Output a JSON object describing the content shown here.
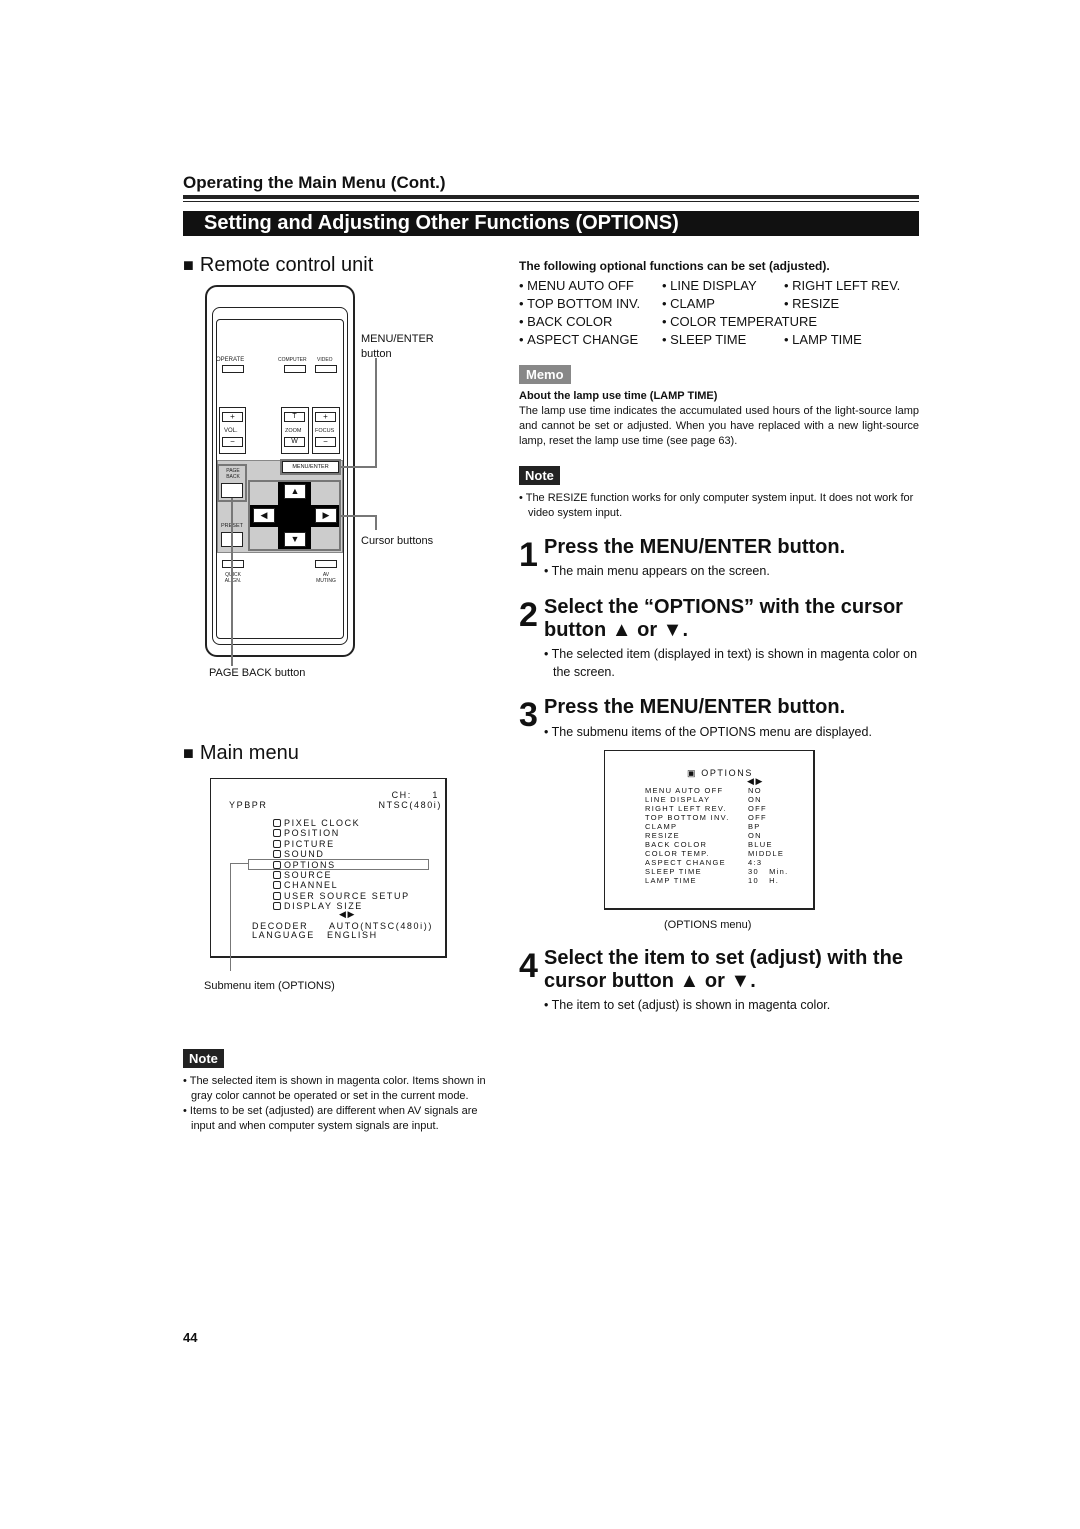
{
  "header": {
    "section": "Operating the Main Menu (Cont.)",
    "title": "Setting and Adjusting Other Functions (OPTIONS)"
  },
  "remote": {
    "heading": "Remote control unit",
    "buttons": {
      "operate": "OPERATE",
      "computer": "COMPUTER",
      "video": "VIDEO",
      "vol": "VOL.",
      "zoom": "ZOOM",
      "focus": "FOCUS",
      "t": "T",
      "w": "W",
      "plus": "+",
      "minus": "−",
      "menu_enter": "MENU/ENTER",
      "page_back": "PAGE BACK",
      "preset": "PRESET",
      "quick_align": "QUICK ALIGN.",
      "av_muting": "AV MUTING"
    },
    "callouts": {
      "menu_enter": "MENU/ENTER button",
      "cursor": "Cursor buttons",
      "page_back": "PAGE BACK button"
    }
  },
  "main_menu": {
    "heading": "Main menu",
    "source": "YPBPR",
    "ch": "CH:     1",
    "signal": "NTSC(480i)",
    "items": [
      "PIXEL CLOCK",
      "POSITION",
      "PICTURE",
      "SOUND",
      "OPTIONS",
      "SOURCE",
      "CHANNEL",
      "USER SOURCE SETUP",
      "DISPLAY SIZE"
    ],
    "selected": "OPTIONS",
    "settings": [
      {
        "label": "DECODER",
        "value": "AUTO(NTSC(480i))"
      },
      {
        "label": "LANGUAGE",
        "value": "ENGLISH"
      }
    ],
    "caption": "Submenu item (OPTIONS)"
  },
  "left_note": {
    "badge": "Note",
    "items": [
      "The selected item is shown in magenta color. Items shown in gray color cannot be operated or set in the current mode.",
      "Items to be set (adjusted) are different when AV signals are input and when computer system signals are input."
    ]
  },
  "functions": {
    "heading": "The following optional functions can be set (adjusted).",
    "rows": [
      [
        "MENU AUTO OFF",
        "LINE DISPLAY",
        "RIGHT LEFT REV."
      ],
      [
        "TOP BOTTOM INV.",
        "CLAMP",
        "RESIZE"
      ],
      [
        "BACK COLOR",
        "COLOR TEMPERATURE",
        ""
      ],
      [
        "ASPECT CHANGE",
        "SLEEP TIME",
        "LAMP TIME"
      ]
    ]
  },
  "memo": {
    "badge": "Memo",
    "heading": "About the lamp use time (LAMP TIME)",
    "text": "The lamp use time indicates the accumulated used hours of the light-source lamp and cannot be set or adjusted. When you have replaced with a new light-source lamp, reset the lamp use time (see page 63)."
  },
  "right_note": {
    "badge": "Note",
    "text": "The RESIZE function works for only computer system input. It does not work for video system input."
  },
  "steps": [
    {
      "num": "1",
      "title": "Press the MENU/ENTER button.",
      "bullet": "The main menu appears on the screen."
    },
    {
      "num": "2",
      "title": "Select the “OPTIONS” with the cursor button ▲ or ▼.",
      "bullet": "The selected item (displayed in text) is shown in magenta color on the screen."
    },
    {
      "num": "3",
      "title": "Press the MENU/ENTER button.",
      "bullet": "The submenu items of the OPTIONS menu are displayed."
    },
    {
      "num": "4",
      "title": "Select the item to set (adjust) with the cursor button ▲ or ▼.",
      "bullet": "The item to set (adjust) is shown in magenta color."
    }
  ],
  "options_menu": {
    "title": "OPTIONS",
    "caption": "(OPTIONS menu)",
    "items": [
      [
        "MENU AUTO OFF",
        "NO"
      ],
      [
        "LINE DISPLAY",
        "ON"
      ],
      [
        "RIGHT LEFT REV.",
        "OFF"
      ],
      [
        "TOP BOTTOM INV.",
        "OFF"
      ],
      [
        "CLAMP",
        "BP"
      ],
      [
        "RESIZE",
        "ON"
      ],
      [
        "BACK COLOR",
        "BLUE"
      ],
      [
        "COLOR TEMP.",
        "MIDDLE"
      ],
      [
        "ASPECT CHANGE",
        "4:3"
      ],
      [
        "SLEEP TIME",
        "30   Min."
      ],
      [
        "LAMP TIME",
        "10   H."
      ]
    ]
  },
  "page_number": "44",
  "colors": {
    "memo_badge": "#888888",
    "note_badge": "#222222"
  }
}
